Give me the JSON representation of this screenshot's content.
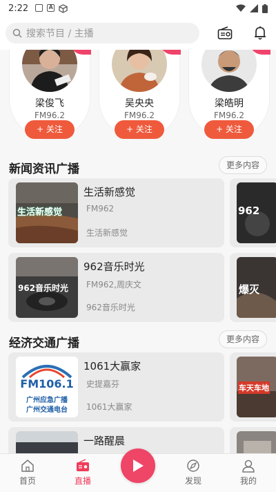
{
  "status": {
    "time": "2:22"
  },
  "search": {
    "placeholder": "搜索节目 / 主播"
  },
  "anchors": [
    {
      "name": "梁俊飞",
      "fm": "FM96.2",
      "follow": "+ 关注"
    },
    {
      "name": "吴央央",
      "fm": "FM96.2",
      "follow": "+ 关注"
    },
    {
      "name": "梁皓明",
      "fm": "FM96.2",
      "follow": "+ 关注"
    }
  ],
  "sections": [
    {
      "title": "新闻资讯广播",
      "more": "更多内容",
      "items": [
        {
          "title": "生活新感觉",
          "sub": "FM962",
          "desc": "生活新感觉",
          "thumb_text": "生活新感觉"
        },
        {
          "title": "962音乐时光",
          "sub": "FM962,周庆文",
          "desc": "962音乐时光",
          "thumb_text": "962音乐时光"
        }
      ],
      "side_texts": [
        "962",
        "爆灭"
      ]
    },
    {
      "title": "经济交通广播",
      "more": "更多内容",
      "items": [
        {
          "title": "1061大赢家",
          "sub": "史提嘉芬",
          "desc": "1061大赢家",
          "thumb_text_1": "FM106.1",
          "thumb_text_2": "广州应急广播",
          "thumb_text_3": "广州交通电台"
        },
        {
          "title": "一路醒晨",
          "sub": "",
          "desc": ""
        }
      ],
      "side_texts": [
        "车天车地"
      ]
    }
  ],
  "tabs": [
    {
      "label": "首页",
      "icon": "home-icon"
    },
    {
      "label": "直播",
      "icon": "radio-icon",
      "active": true
    },
    {
      "label": "发现",
      "icon": "compass-icon"
    },
    {
      "label": "我的",
      "icon": "user-icon"
    }
  ],
  "colors": {
    "accent": "#ef4566",
    "follow": "#ef5a3c",
    "pink": "#f0436a"
  }
}
